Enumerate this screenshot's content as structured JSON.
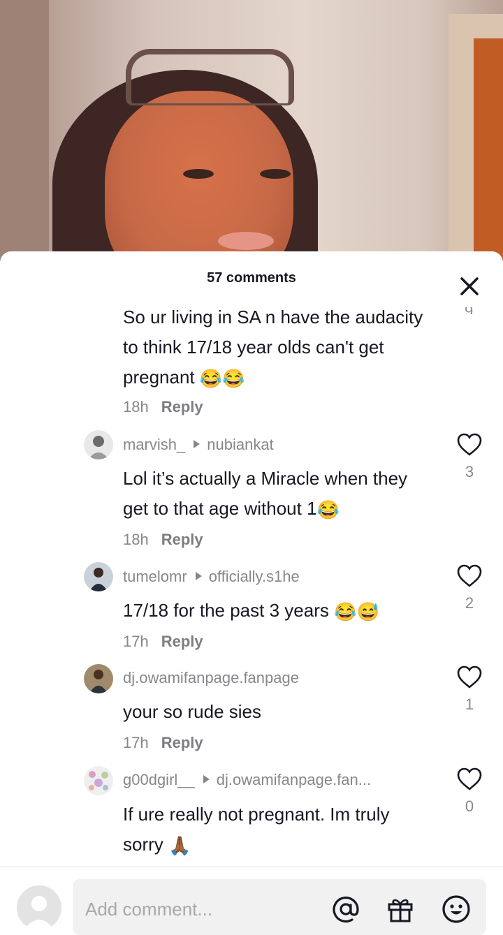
{
  "sheet": {
    "title": "57 comments",
    "peek_count": "9"
  },
  "comments": [
    {
      "text": "So ur living in SA n have the audacity to think 17/18 year olds can't get pregnant",
      "emoji": "😂😂",
      "time": "18h",
      "reply_label": "Reply"
    },
    {
      "username": "marvish_",
      "reply_to": "nubiankat",
      "text": "Lol it’s actually a Miracle when they get to that age without 1",
      "emoji": "😂",
      "time": "18h",
      "reply_label": "Reply",
      "likes": "3"
    },
    {
      "username": "tumelomr",
      "reply_to": "officially.s1he",
      "text": "17/18 for the past 3 years",
      "emoji": "😂😅",
      "time": "17h",
      "reply_label": "Reply",
      "likes": "2"
    },
    {
      "username": "dj.owamifanpage.fanpage",
      "text": "your so rude sies",
      "time": "17h",
      "reply_label": "Reply",
      "likes": "1"
    },
    {
      "username": "g00dgirl__",
      "reply_to": "dj.owamifanpage.fan...",
      "text": "If ure really not pregnant. Im truly sorry",
      "emoji": "🙏🏾",
      "likes": "0"
    }
  ],
  "input": {
    "placeholder": "Add comment..."
  },
  "icons": [
    "close-icon",
    "heart-icon",
    "mention-icon",
    "gift-icon",
    "emoji-icon"
  ],
  "colors": {
    "text": "#161823",
    "muted": "#86878b",
    "background": "#ffffff"
  }
}
